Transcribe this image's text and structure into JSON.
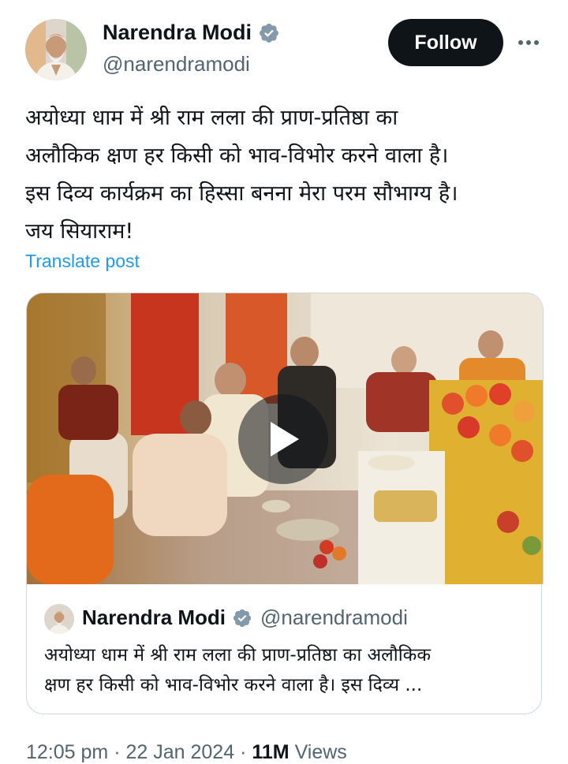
{
  "author": {
    "display_name": "Narendra Modi",
    "handle": "@narendramodi",
    "verified_icon": "verified-badge-icon"
  },
  "actions": {
    "follow_label": "Follow",
    "more_icon": "more-options-icon"
  },
  "post": {
    "lines": [
      "अयोध्या धाम में श्री राम लला की प्राण-प्रतिष्ठा का",
      "अलौकिक क्षण हर किसी को भाव-विभोर करने वाला है।",
      "इस दिव्य कार्यक्रम का हिस्सा बनना मेरा परम सौभाग्य है।",
      "जय सियाराम!"
    ],
    "translate_label": "Translate post"
  },
  "media": {
    "type": "video",
    "play_icon": "play-icon"
  },
  "quote": {
    "display_name": "Narendra Modi",
    "handle": "@narendramodi",
    "lines": [
      "अयोध्या धाम में श्री राम लला की प्राण-प्रतिष्ठा का अलौकिक",
      "क्षण हर किसी को भाव-विभोर करने वाला है। इस दिव्य ..."
    ]
  },
  "meta": {
    "time": "12:05 pm",
    "date": "22 Jan 2024",
    "views_count": "11M",
    "views_label": "Views",
    "separator": "·"
  },
  "colors": {
    "accent": "#1d9bf0",
    "text": "#0f1419",
    "secondary": "#536471",
    "border": "#cfd9de"
  }
}
